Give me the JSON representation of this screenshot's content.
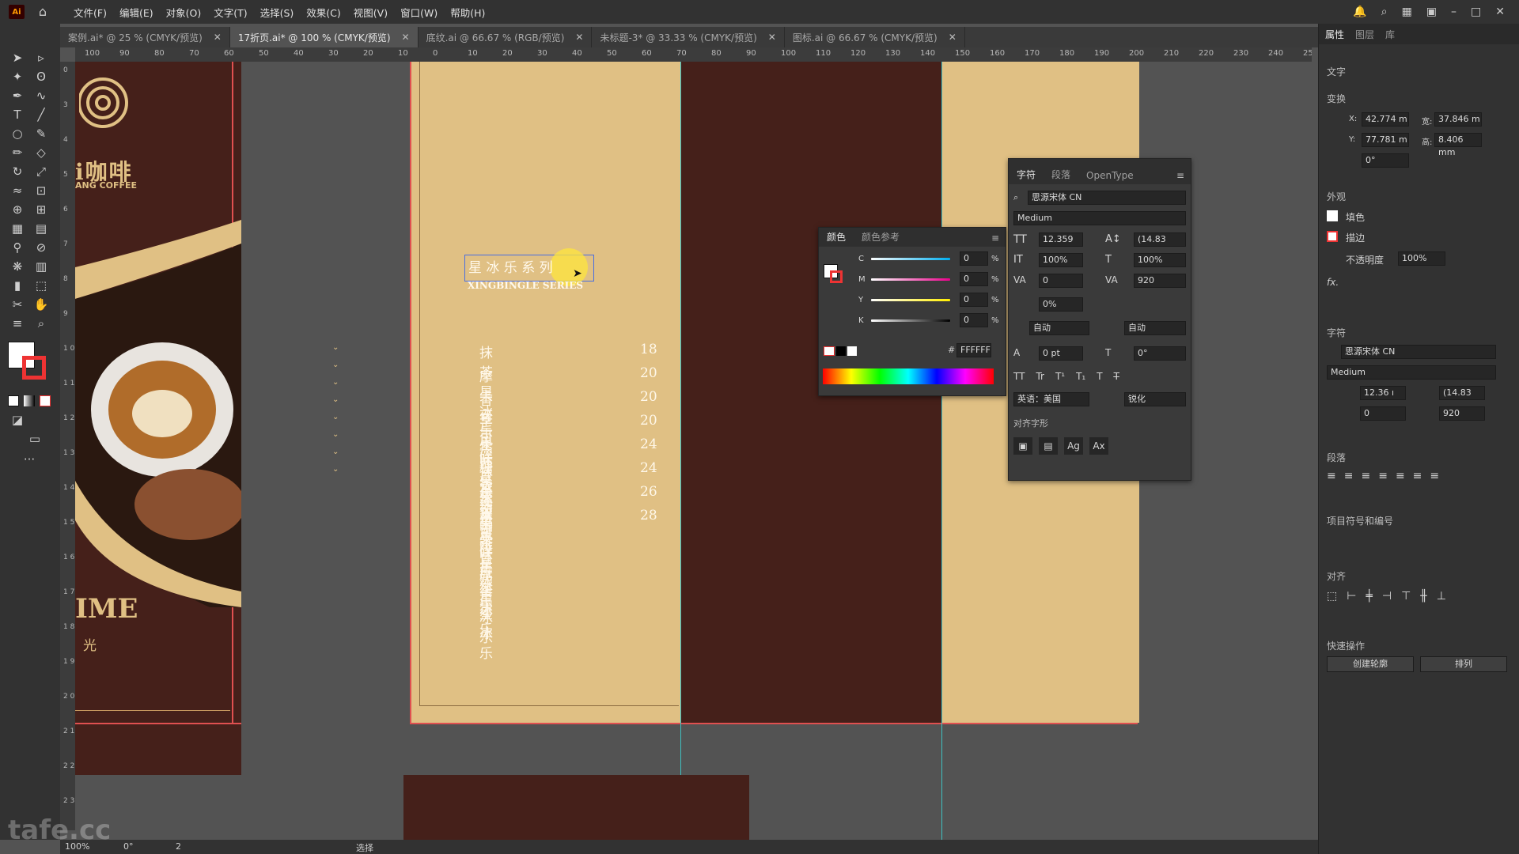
{
  "menubar": {
    "logo": "Ai",
    "items": [
      "文件(F)",
      "编辑(E)",
      "对象(O)",
      "文字(T)",
      "选择(S)",
      "效果(C)",
      "视图(V)",
      "窗口(W)",
      "帮助(H)"
    ]
  },
  "tabs": [
    {
      "label": "案例.ai* @ 25 % (CMYK/预览)"
    },
    {
      "label": "17折页.ai* @ 100 % (CMYK/预览)"
    },
    {
      "label": "底纹.ai @ 66.67 % (RGB/预览)"
    },
    {
      "label": "未标题-3* @ 33.33 % (CMYK/预览)"
    },
    {
      "label": "图标.ai @ 66.67 % (CMYK/预览)"
    }
  ],
  "ruler": {
    "h_ticks": [
      "100",
      "90",
      "80",
      "70",
      "60",
      "50",
      "40",
      "30",
      "20",
      "10",
      "0",
      "10",
      "20",
      "30",
      "40",
      "50",
      "60",
      "70",
      "80",
      "90",
      "100",
      "110",
      "120",
      "130",
      "140",
      "150",
      "160",
      "170",
      "180",
      "190",
      "200",
      "210",
      "220",
      "230",
      "240",
      "250"
    ],
    "v_ticks": [
      "0",
      "3",
      "4",
      "5",
      "6",
      "7",
      "8",
      "9",
      "1 0",
      "1 1",
      "1 2",
      "1 3",
      "1 4",
      "1 5",
      "1 6",
      "1 7",
      "1 8",
      "1 9",
      "2 0",
      "2 1",
      "2 2",
      "2 3"
    ]
  },
  "artboard": {
    "logo_text": "咖啡",
    "logo_prefix": "i",
    "logo_sub": "ANG COFFEE",
    "time_text": "IME",
    "time_sub": "光",
    "title_cn": "星 冰 乐 系 列",
    "title_en": "XINGBINGLE SERIES",
    "menu": [
      {
        "name": "抹茶星冰乐",
        "price": "18"
      },
      {
        "name": "摩卡可可碎片星冰乐",
        "price": "20"
      },
      {
        "name": "香草风味星冰乐",
        "price": "20"
      },
      {
        "name": "芒果西番莲果茶星冰乐",
        "price": "20"
      },
      {
        "name": "焦糖浓缩咖啡星冰乐",
        "price": "24"
      },
      {
        "name": "抹茶可可碎片星冰乐",
        "price": "24"
      },
      {
        "name": "榛果风味摩卡星冰乐",
        "price": "26"
      },
      {
        "name": "芒果豆奶星冰乐",
        "price": "28"
      }
    ],
    "colors": {
      "tan": "#e0c084",
      "brown": "#45201a",
      "cream": "#fff8ea"
    }
  },
  "color_panel": {
    "tabs": [
      "颜色",
      "颜色参考"
    ],
    "channels": [
      {
        "label": "C",
        "value": "0",
        "unit": "%"
      },
      {
        "label": "M",
        "value": "0",
        "unit": "%"
      },
      {
        "label": "Y",
        "value": "0",
        "unit": "%"
      },
      {
        "label": "K",
        "value": "0",
        "unit": "%"
      }
    ],
    "hex_label": "#",
    "hex": "FFFFFF"
  },
  "char_panel": {
    "tabs": [
      "字符",
      "段落",
      "OpenType"
    ],
    "font": "思源宋体 CN",
    "weight": "Medium",
    "size": "12.359",
    "leading": "(14.83",
    "vscale": "100%",
    "hscale": "100%",
    "kerning": "0",
    "tracking": "920",
    "tsume": "0%",
    "auto1": "自动",
    "auto2": "自动",
    "baseline": "0 pt",
    "rotation": "0°",
    "language": "英语：美国",
    "aa": "锐化",
    "align_label": "对齐字形"
  },
  "props_panel": {
    "tabs": [
      "属性",
      "图层",
      "库"
    ],
    "section_text": "文字",
    "section_transform": "变换",
    "x_label": "X:",
    "x": "42.774 m",
    "y_label": "Y:",
    "y": "77.781 m",
    "w_label": "宽:",
    "w": "37.846 m",
    "h_label": "高:",
    "h": "8.406 mm",
    "angle": "0°",
    "section_appearance": "外观",
    "fill": "填色",
    "stroke": "描边",
    "opacity_label": "不透明度",
    "opacity": "100%",
    "fx": "fx.",
    "section_char": "字符",
    "font": "思源宋体 CN",
    "weight": "Medium",
    "size": "12.36 ı",
    "leading": "(14.83",
    "kerning": "0",
    "tracking": "920",
    "section_para": "段落",
    "section_bullets": "项目符号和编号",
    "section_align": "对齐",
    "section_quick": "快速操作",
    "btn_outline": "创建轮廓",
    "btn_arrange": "排列"
  },
  "status": {
    "zoom": "100%",
    "angle": "0°",
    "page": "2",
    "mode": "选择",
    "watermark": "tafe.cc"
  }
}
